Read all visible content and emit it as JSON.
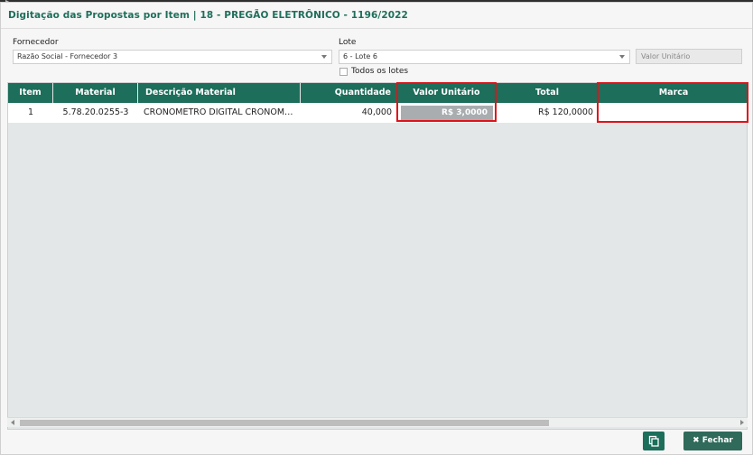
{
  "dialog": {
    "title": "Digitação das Propostas por Item | 18 - PREGÃO ELETRÔNICO - 1196/2022"
  },
  "filters": {
    "fornecedor_label": "Fornecedor",
    "fornecedor_value": "Razão Social - Fornecedor 3",
    "lote_label": "Lote",
    "lote_value": "6 - Lote 6",
    "valor_unitario_placeholder": "Valor Unitário",
    "todos_os_lotes_label": "Todos os lotes"
  },
  "grid": {
    "columns": [
      "Item",
      "Material",
      "Descrição Material",
      "Quantidade",
      "Valor Unitário",
      "Total",
      "Marca"
    ],
    "rows": [
      {
        "item": "1",
        "material": "5.78.20.0255-3",
        "descricao": "CRONOMETRO DIGITAL CRONOM…",
        "quantidade": "40,000",
        "valor_unitario": "R$ 3,0000",
        "total": "R$ 120,0000",
        "marca": ""
      }
    ]
  },
  "footer": {
    "close_label": "Fechar"
  },
  "colors": {
    "header_green": "#1d6e5b",
    "highlight_red": "#e0131a"
  }
}
